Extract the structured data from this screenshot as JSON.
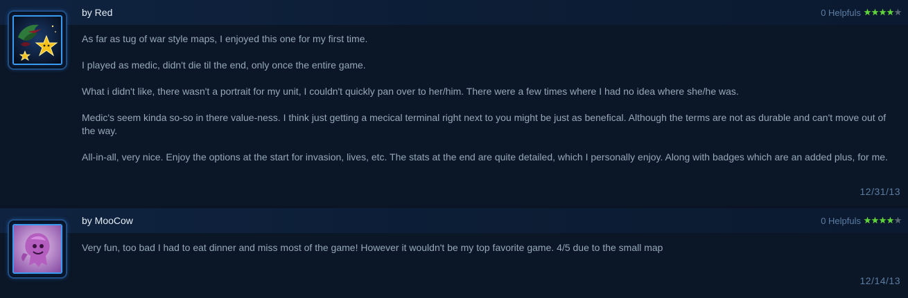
{
  "reviews": [
    {
      "author": "by Red",
      "helpfuls": "0 Helpfuls",
      "rating": 4,
      "rating_max": 5,
      "paragraphs": [
        "As far as tug of war style maps, I enjoyed this one for my first time.",
        "I played as medic, didn't die til the end, only once the entire game.",
        "What i didn't like, there wasn't a portrait for my unit, I couldn't quickly pan over to her/him. There were a few times where I had no idea where she/he was.",
        "Medic's seem kinda so-so in there value-ness. I think just getting a mecical terminal right next to you might be just as benefical. Although the terms are not as durable and can't move out of the way.",
        "All-in-all, very nice. Enjoy the options at the start for invasion, lives, etc. The stats at the end are quite detailed, which I personally enjoy. Along with badges which are an added plus, for me."
      ],
      "date": "12/31/13",
      "avatar_icon": "hydralisk-star-portrait-icon"
    },
    {
      "author": "by MooCow",
      "helpfuls": "0 Helpfuls",
      "rating": 4,
      "rating_max": 5,
      "paragraphs": [
        "Very fun, too bad I had to eat dinner and miss most of the game! However it wouldn't be my top favorite game. 4/5 due to the small map"
      ],
      "date": "12/14/13",
      "avatar_icon": "pink-creature-portrait-icon"
    }
  ],
  "colors": {
    "star_filled": "#5fd33a",
    "star_empty": "#5a6472"
  }
}
